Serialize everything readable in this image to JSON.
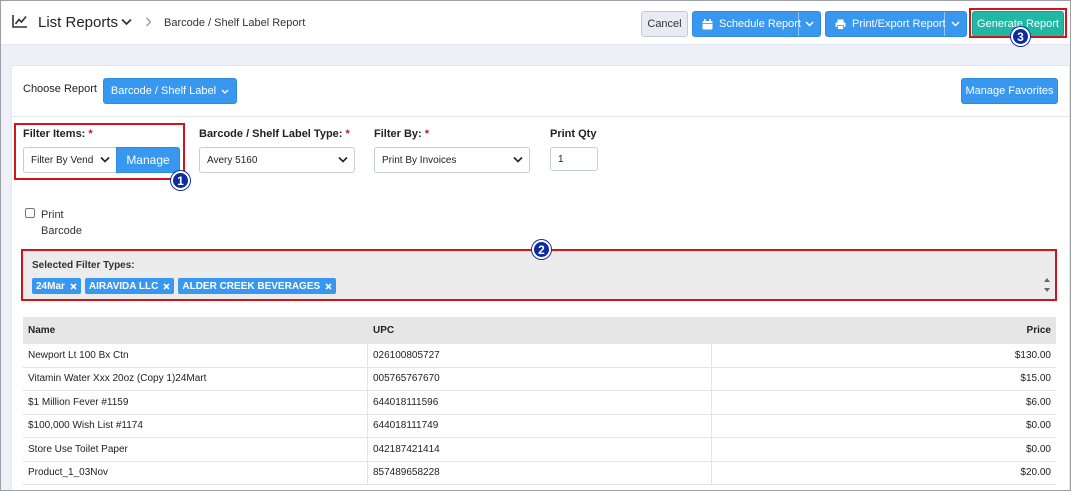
{
  "header": {
    "title": "List Reports",
    "breadcrumb": "Barcode / Shelf Label Report",
    "cancel_label": "Cancel",
    "schedule_label": "Schedule Report",
    "print_label": "Print/Export Report",
    "generate_label": "Generate Report"
  },
  "choose": {
    "label": "Choose Report",
    "value": "Barcode / Shelf Label",
    "favorites_label": "Manage Favorites"
  },
  "filters": {
    "filter_items_label": "Filter Items:",
    "filter_items_value": "Filter By Vend",
    "manage_label": "Manage",
    "label_type_label": "Barcode / Shelf Label Type:",
    "label_type_value": "Avery 5160",
    "filter_by_label": "Filter By:",
    "filter_by_value": "Print By Invoices",
    "print_qty_label": "Print Qty",
    "print_qty_value": "1",
    "required_mark": "*"
  },
  "print_barcode": {
    "label_line1": "Print",
    "label_line2": "Barcode"
  },
  "selected_filters": {
    "title": "Selected Filter Types:",
    "chips": [
      "24Mar",
      "AIRAVIDA LLC",
      "ALDER CREEK BEVERAGES"
    ]
  },
  "table": {
    "headers": [
      "Name",
      "UPC",
      "Price"
    ],
    "rows": [
      [
        "Newport Lt 100 Bx Ctn",
        "026100805727",
        "$130.00"
      ],
      [
        "Vitamin Water Xxx 20oz (Copy 1)24Mart",
        "005765767670",
        "$15.00"
      ],
      [
        "$1 Million Fever #1159",
        "644018111596",
        "$6.00"
      ],
      [
        "$100,000 Wish List #1174",
        "644018111749",
        "$0.00"
      ],
      [
        "Store Use Toilet Paper",
        "042187421414",
        "$0.00"
      ],
      [
        "Product_1_03Nov",
        "857489658228",
        "$20.00"
      ]
    ]
  },
  "annotations": {
    "badge_1": "1",
    "badge_2": "2",
    "badge_3": "3"
  },
  "colors": {
    "primary_blue": "#3897ef",
    "generate_teal": "#20b7a5",
    "highlight_red": "#d0141c",
    "badge_navy": "#0d2a9e"
  },
  "icons": {
    "title": "line-chart-icon",
    "schedule": "calendar-icon",
    "print": "printer-icon",
    "chip_remove": "close-icon"
  }
}
